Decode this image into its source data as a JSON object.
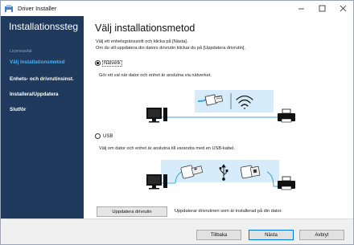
{
  "window": {
    "title": "Driver Installer"
  },
  "sidebar": {
    "title": "Installationssteg",
    "subtitle": "Licensavtal",
    "steps": [
      {
        "label": "Välj installationsmetod",
        "active": true
      },
      {
        "label": "Enhets- och drivrutinsinst.",
        "active": false
      },
      {
        "label": "Installera/Uppdatera",
        "active": false
      },
      {
        "label": "Slutför",
        "active": false
      }
    ]
  },
  "main": {
    "title": "Välj installationsmetod",
    "intro_line1": "Välj ett enhetsgränssnitt och klicka på [Nästa].",
    "intro_line2": "Om du vill uppdatera din dators drivrutin klickar du på [Uppdatera drivrutin].",
    "options": {
      "network": {
        "label": "Nätverk",
        "selected": true,
        "description": "Gör ett val när dator och enhet är anslutna via nätverket."
      },
      "usb": {
        "label": "USB",
        "selected": false,
        "description": "Välj om dator och enhet är anslutna till varandra med en USB-kabel."
      }
    },
    "update_button": "Uppdatera drivrutin",
    "update_note": "Uppdaterar drivrutinen som är installerad på din dator."
  },
  "footer": {
    "back": "Tillbaka",
    "next": "Nästa",
    "cancel": "Avbryt"
  },
  "colors": {
    "sidebar_bg": "#1f3a5c",
    "active_step": "#47b3ff",
    "network_line": "#3aa3e3",
    "illustration_panel": "#d6ecfa"
  }
}
